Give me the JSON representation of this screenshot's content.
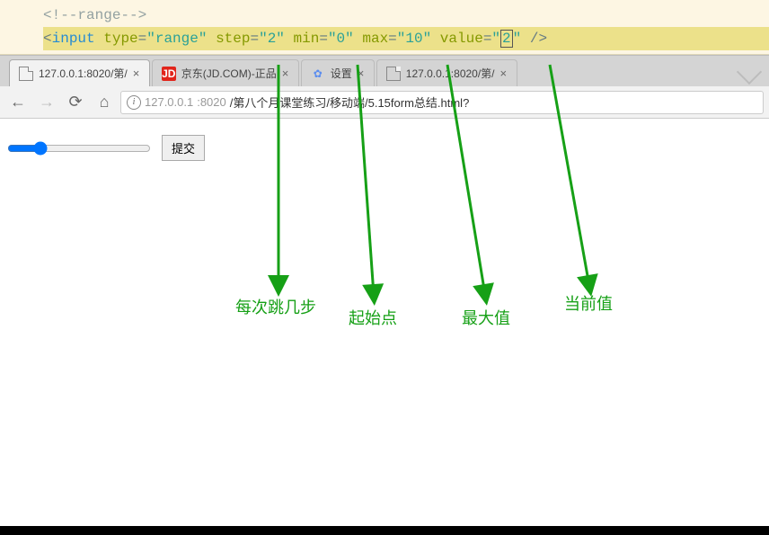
{
  "code": {
    "comment": "<!--range-->",
    "tag": "input",
    "attrs": {
      "type": "range",
      "step": "2",
      "min": "0",
      "max": "10",
      "value": "2"
    }
  },
  "tabs": [
    {
      "favicon": "page",
      "title": "127.0.0.1:8020/第/"
    },
    {
      "favicon": "jd",
      "title": "京东(JD.COM)-正品"
    },
    {
      "favicon": "gear",
      "title": "设置"
    },
    {
      "favicon": "page",
      "title": "127.0.0.1:8020/第/"
    }
  ],
  "url": {
    "host": "127.0.0.1",
    "port": ":8020",
    "path": "/第八个月课堂练习/移动端/5.15form总结.html?"
  },
  "form": {
    "submit_label": "提交",
    "range": {
      "min": 0,
      "max": 10,
      "step": 2,
      "value": 2
    }
  },
  "annotations": {
    "step": "每次跳几步",
    "min": "起始点",
    "max": "最大值",
    "value": "当前值"
  }
}
